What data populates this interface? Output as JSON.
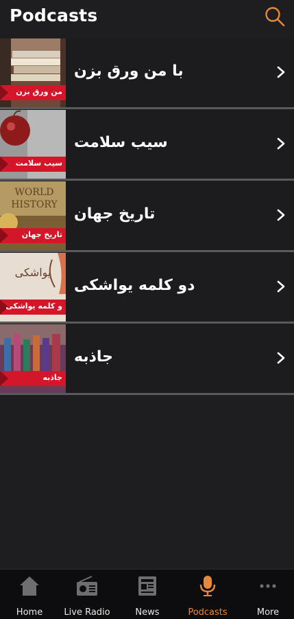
{
  "header": {
    "title": "Podcasts",
    "search_icon": "search-icon",
    "accent": "#e8893a"
  },
  "podcasts": [
    {
      "title": "با من ورق بزن",
      "banner": "من ورق بزن",
      "art": "books"
    },
    {
      "title": "سیب سلامت",
      "banner": "سیب سلامت",
      "art": "apple"
    },
    {
      "title": "تاریخ جهان",
      "banner": "تاریخ جهان",
      "art": "world-history",
      "art_text_1": "WORLD",
      "art_text_2": "HISTORY"
    },
    {
      "title": "دو کلمه یواشکی",
      "banner": "و کلمه یواشکی",
      "art": "sketch",
      "art_text_1": "یواشکی"
    },
    {
      "title": "جاذبه",
      "banner": "جاذبه",
      "art": "crowd"
    }
  ],
  "tabbar": {
    "active": "Podcasts",
    "items": [
      {
        "label": "Home",
        "icon": "home-icon"
      },
      {
        "label": "Live Radio",
        "icon": "radio-icon"
      },
      {
        "label": "News",
        "icon": "newspaper-icon"
      },
      {
        "label": "Podcasts",
        "icon": "microphone-icon"
      },
      {
        "label": "More",
        "icon": "more-dots-icon"
      }
    ]
  }
}
